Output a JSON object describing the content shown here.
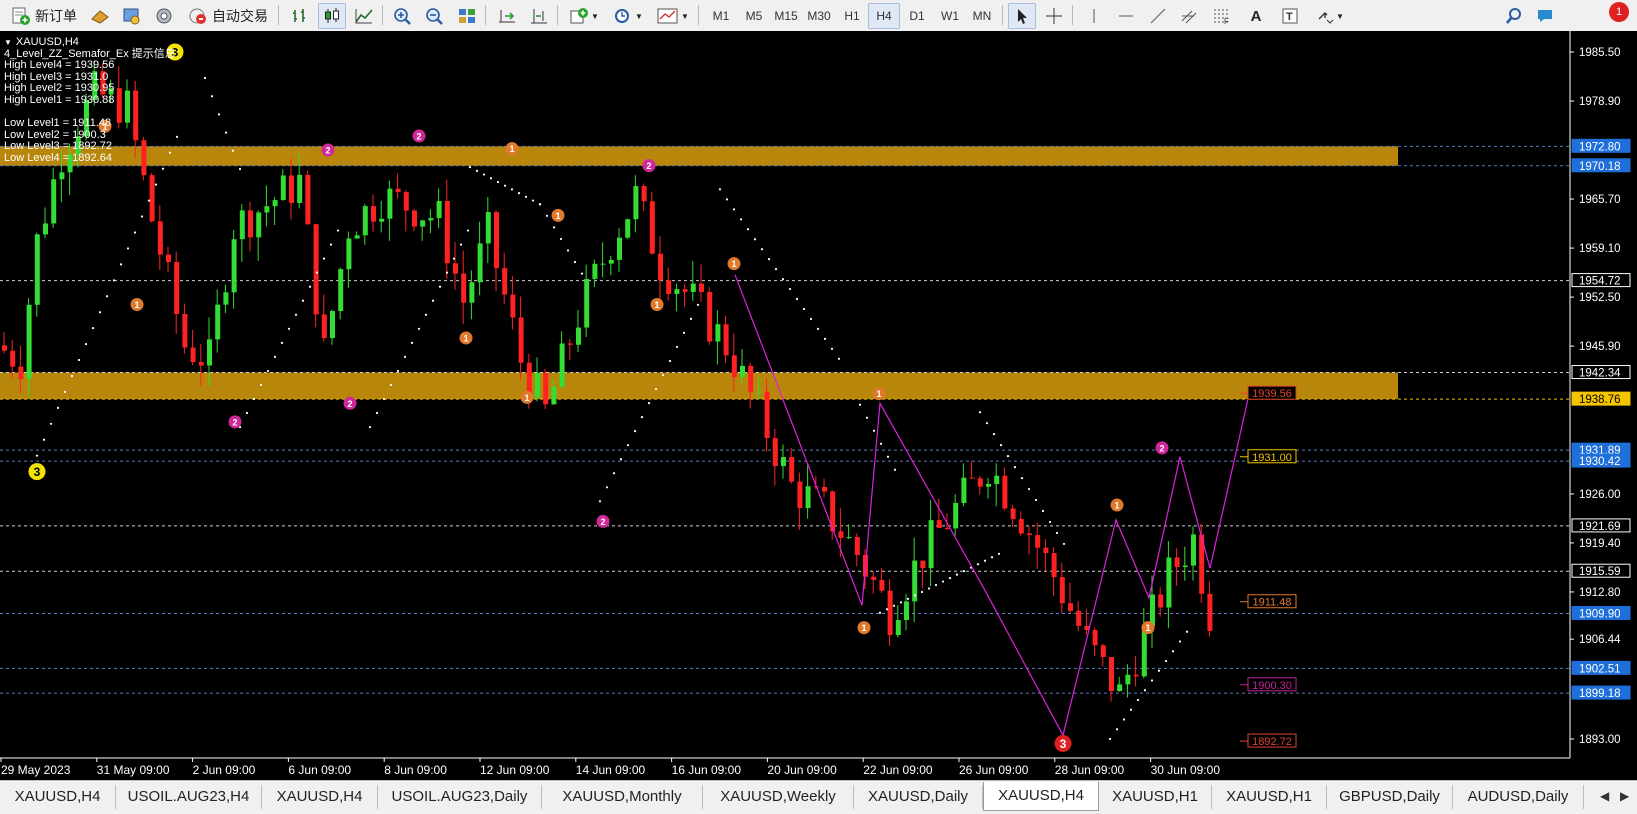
{
  "toolbar": {
    "new_order": "新订单",
    "auto_trading": "自动交易",
    "timeframes": [
      "M1",
      "M5",
      "M15",
      "M30",
      "H1",
      "H4",
      "D1",
      "W1",
      "MN"
    ],
    "active_timeframe": "H4",
    "notifications": "1"
  },
  "chart": {
    "header": "XAUUSD,H4",
    "indicator_title": "4_Level_ZZ_Semafor_Ex 提示信息:",
    "info_lines": [
      "High Level4 = 1939.56",
      "High Level3 = 1931.0",
      "High Level2 = 1930.95",
      "High Level1 = 1930.88",
      "",
      "Low Level1 = 1911.48",
      "Low Level2 = 1900.3",
      "Low Level3 = 1892.72",
      "Low Level4 = 1892.64"
    ],
    "price_scale": [
      "1985.50",
      "1978.90",
      "1965.70",
      "1959.10",
      "1952.50",
      "1945.90",
      "1926.00",
      "1919.40",
      "1912.80",
      "1906.44",
      "1893.00"
    ],
    "price_tags": [
      {
        "label": "1972.80",
        "price": 1972.8,
        "bg": "#1e6fd9"
      },
      {
        "label": "1970.18",
        "price": 1970.18,
        "bg": "#1e6fd9"
      },
      {
        "label": "1954.72",
        "price": 1954.72,
        "bg": "#000000"
      },
      {
        "label": "1942.34",
        "price": 1942.34,
        "bg": "#000000"
      },
      {
        "label": "1938.76",
        "price": 1938.76,
        "bg": "#f4c400"
      },
      {
        "label": "1931.89",
        "price": 1931.89,
        "bg": "#1e6fd9"
      },
      {
        "label": "1930.42",
        "price": 1930.42,
        "bg": "#1e6fd9"
      },
      {
        "label": "1921.69",
        "price": 1921.69,
        "bg": "#000000"
      },
      {
        "label": "1915.59",
        "price": 1915.59,
        "bg": "#000000"
      },
      {
        "label": "1909.90",
        "price": 1909.9,
        "bg": "#1e6fd9"
      },
      {
        "label": "1902.51",
        "price": 1902.51,
        "bg": "#1e6fd9"
      },
      {
        "label": "1899.18",
        "price": 1899.18,
        "bg": "#1e6fd9"
      }
    ],
    "level_tags": [
      {
        "label": "1939.56",
        "price": 1939.56,
        "color": "#e0442a"
      },
      {
        "label": "1931.00",
        "price": 1931.0,
        "color": "#f4c400"
      },
      {
        "label": "1911.48",
        "price": 1911.48,
        "color": "#e07a2a"
      },
      {
        "label": "1900.30",
        "price": 1900.3,
        "color": "#c0209a"
      },
      {
        "label": "1892.72",
        "price": 1892.72,
        "color": "#e0442a"
      }
    ],
    "zones": [
      {
        "top": 1972.8,
        "bottom": 1970.18
      },
      {
        "top": 1942.34,
        "bottom": 1938.76
      }
    ],
    "time_labels": [
      "29 May 2023",
      "31 May 09:00",
      "2 Jun 09:00",
      "6 Jun 09:00",
      "8 Jun 09:00",
      "12 Jun 09:00",
      "14 Jun 09:00",
      "16 Jun 09:00",
      "20 Jun 09:00",
      "22 Jun 09:00",
      "26 Jun 09:00",
      "28 Jun 09:00",
      "30 Jun 09:00"
    ],
    "semafor_marks": [
      "1",
      "2",
      "3"
    ],
    "colors": {
      "bull": "#33dd33",
      "bear": "#ff2222",
      "zone": "#b8860b",
      "zigzag": "#dd22dd",
      "grid": "#5a7fbf"
    }
  },
  "tabs": [
    "XAUUSD,H4",
    "USOIL.AUG23,H4",
    "XAUUSD,H4",
    "USOIL.AUG23,Daily",
    "XAUUSD,Monthly",
    "XAUUSD,Weekly",
    "XAUUSD,Daily",
    "XAUUSD,H4",
    "XAUUSD,H1",
    "XAUUSD,H1",
    "GBPUSD,Daily",
    "AUDUSD,Daily"
  ],
  "active_tab": 7
}
